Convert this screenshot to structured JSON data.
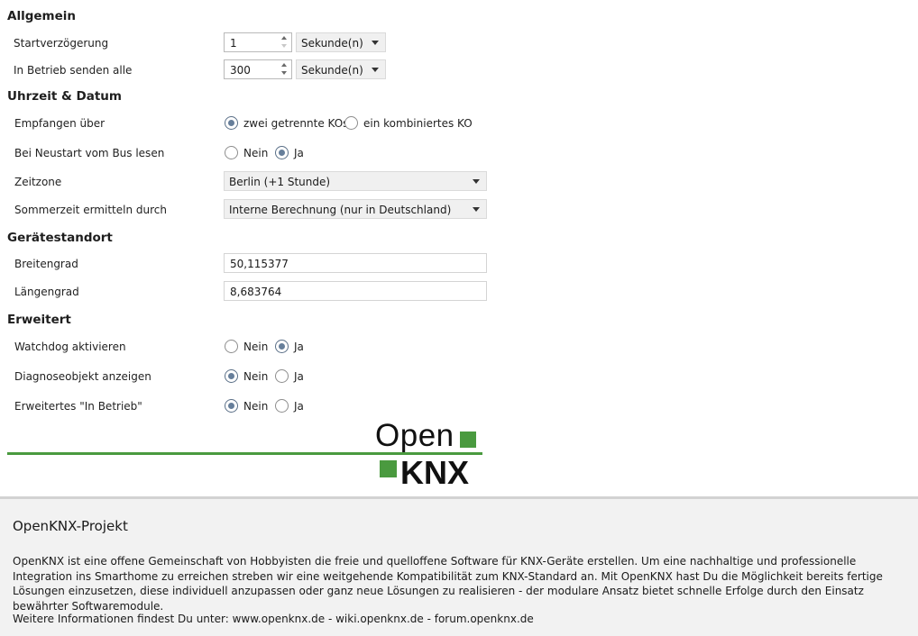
{
  "sections": {
    "allgemein": "Allgemein",
    "uhrzeit": "Uhrzeit & Datum",
    "standort": "Gerätestandort",
    "erweitert": "Erweitert"
  },
  "allgemein": {
    "startverzoegerung": {
      "label": "Startverzögerung",
      "value": "1",
      "unit": "Sekunde(n)"
    },
    "in_betrieb": {
      "label": "In Betrieb senden alle",
      "value": "300",
      "unit": "Sekunde(n)"
    }
  },
  "uhrzeit": {
    "empfangen": {
      "label": "Empfangen über",
      "option1": "zwei getrennte KOs",
      "option2": "ein kombiniertes KO",
      "selected": "option1"
    },
    "neustart": {
      "label": "Bei Neustart vom Bus lesen",
      "option1": "Nein",
      "option2": "Ja",
      "selected": "option2"
    },
    "zeitzone": {
      "label": "Zeitzone",
      "value": "Berlin (+1 Stunde)"
    },
    "sommerzeit": {
      "label": "Sommerzeit ermitteln durch",
      "value": "Interne Berechnung (nur in Deutschland)"
    }
  },
  "standort": {
    "breitengrad": {
      "label": "Breitengrad",
      "value": "50,115377"
    },
    "laengengrad": {
      "label": "Längengrad",
      "value": "8,683764"
    }
  },
  "erweitert": {
    "watchdog": {
      "label": "Watchdog aktivieren",
      "option1": "Nein",
      "option2": "Ja",
      "selected": "option2"
    },
    "diagnose": {
      "label": "Diagnoseobjekt anzeigen",
      "option1": "Nein",
      "option2": "Ja",
      "selected": "option1"
    },
    "in_betrieb_erw": {
      "label": "Erweitertes \"In Betrieb\"",
      "option1": "Nein",
      "option2": "Ja",
      "selected": "option1"
    }
  },
  "logo": {
    "line1": "Open",
    "line2": "KNX",
    "color": "#4a9a3f"
  },
  "footer": {
    "title": "OpenKNX-Projekt",
    "text": "OpenKNX ist eine offene Gemeinschaft von Hobbyisten die freie und quelloffene Software für KNX-Geräte erstellen. Um eine nachhaltige und professionelle Integration ins Smarthome zu erreichen streben wir eine weitgehende Kompatibilität zum KNX-Standard an. Mit OpenKNX hast Du die Möglichkeit bereits fertige Lösungen einzusetzen, diese individuell anzupassen oder ganz neue Lösungen zu realisieren - der modulare Ansatz bietet schnelle Erfolge durch den Einsatz bewährter Softwaremodule.",
    "links": "Weitere Informationen findest Du unter: www.openknx.de - wiki.openknx.de - forum.openknx.de"
  }
}
